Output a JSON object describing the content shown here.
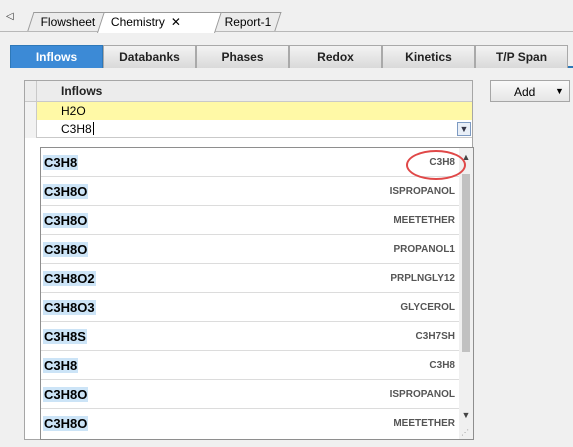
{
  "doc_tabs": [
    {
      "label": "Flowsheet",
      "active": false
    },
    {
      "label": "Chemistry",
      "active": true,
      "close": "✕"
    },
    {
      "label": "Report-1",
      "active": false
    }
  ],
  "tab_scroll_icon": "◁",
  "sub_tabs": [
    "Inflows",
    "Databanks",
    "Phases",
    "Redox",
    "Kinetics",
    "T/P Span"
  ],
  "active_sub_tab": "Inflows",
  "grid": {
    "header": "Inflows",
    "rows": [
      {
        "value": "H2O"
      },
      {
        "value": "C3H8",
        "editing": true
      }
    ]
  },
  "dropdown": {
    "items": [
      {
        "formula": "C3H8",
        "name": "C3H8",
        "highlighted": true
      },
      {
        "formula": "C3H8O",
        "name": "ISPROPANOL"
      },
      {
        "formula": "C3H8O",
        "name": "MEETETHER"
      },
      {
        "formula": "C3H8O",
        "name": "PROPANOL1"
      },
      {
        "formula": "C3H8O2",
        "name": "PRPLNGLY12"
      },
      {
        "formula": "C3H8O3",
        "name": "GLYCEROL"
      },
      {
        "formula": "C3H8S",
        "name": "C3H7SH"
      },
      {
        "formula": "C3H8",
        "name": "C3H8"
      },
      {
        "formula": "C3H8O",
        "name": "ISPROPANOL"
      },
      {
        "formula": "C3H8O",
        "name": "MEETETHER"
      }
    ]
  },
  "add_button": {
    "label": "Add"
  },
  "colors": {
    "active_tab": "#3c8ad6",
    "selected_row": "#fff9a6",
    "highlight_match": "#cce4f7",
    "annotation_circle": "#e04848"
  }
}
